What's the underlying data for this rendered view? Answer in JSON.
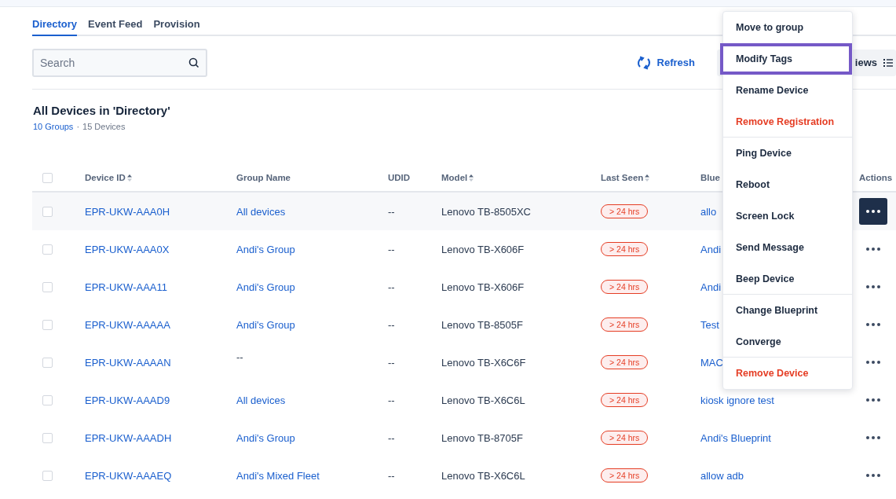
{
  "tabs": [
    {
      "label": "Directory",
      "selected": true
    },
    {
      "label": "Event Feed",
      "selected": false
    },
    {
      "label": "Provision",
      "selected": false
    }
  ],
  "search": {
    "placeholder": "Search"
  },
  "toolbar": {
    "refresh": "Refresh",
    "views": "iews"
  },
  "select_all": {
    "checked": false
  },
  "heading": {
    "title": "All Devices in 'Directory'",
    "groups_link": "10 Groups",
    "separator": "·",
    "devices": "15 Devices"
  },
  "table": {
    "columns": [
      {
        "label": "Device ID",
        "sortable": true
      },
      {
        "label": "Group Name",
        "sortable": false
      },
      {
        "label": "UDID",
        "sortable": false
      },
      {
        "label": "Model",
        "sortable": true
      },
      {
        "label": "Last Seen",
        "sortable": true
      },
      {
        "label": "Blue",
        "sortable": false
      },
      {
        "label": "Actions",
        "sortable": false
      }
    ],
    "rows": [
      {
        "device_id": "EPR-UKW-AAA0H",
        "group": "All devices",
        "udid": "--",
        "model": "Lenovo TB-8505XC",
        "last_seen": "> 24 hrs",
        "blueprint": "allo",
        "selected": true
      },
      {
        "device_id": "EPR-UKW-AAA0X",
        "group": "Andi's Group",
        "udid": "--",
        "model": "Lenovo TB-X606F",
        "last_seen": "> 24 hrs",
        "blueprint": "Andi",
        "selected": false
      },
      {
        "device_id": "EPR-UKW-AAA11",
        "group": "Andi's Group",
        "udid": "--",
        "model": "Lenovo TB-X606F",
        "last_seen": "> 24 hrs",
        "blueprint": "Andi",
        "selected": false
      },
      {
        "device_id": "EPR-UKW-AAAAA",
        "group": "Andi's Group",
        "udid": "--",
        "model": "Lenovo TB-8505F",
        "last_seen": "> 24 hrs",
        "blueprint": "Test",
        "selected": false
      },
      {
        "device_id": "EPR-UKW-AAAAN",
        "group": "--",
        "udid": "--",
        "model": "Lenovo TB-X6C6F",
        "last_seen": "> 24 hrs",
        "blueprint": "MAC",
        "selected": false
      },
      {
        "device_id": "EPR-UKW-AAAD9",
        "group": "All devices",
        "udid": "--",
        "model": "Lenovo TB-X6C6L",
        "last_seen": "> 24 hrs",
        "blueprint": "kiosk ignore test",
        "selected": false
      },
      {
        "device_id": "EPR-UKW-AAADH",
        "group": "Andi's Group",
        "udid": "--",
        "model": "Lenovo TB-8705F",
        "last_seen": "> 24 hrs",
        "blueprint": "Andi's Blueprint",
        "selected": false
      },
      {
        "device_id": "EPR-UKW-AAAEQ",
        "group": "Andi's Mixed Fleet",
        "udid": "--",
        "model": "Lenovo TB-X6C6L",
        "last_seen": "> 24 hrs",
        "blueprint": "allow adb",
        "selected": false
      }
    ]
  },
  "menu": {
    "items": [
      {
        "label": "Move to group",
        "kind": "normal",
        "selected": false,
        "divider_after": false
      },
      {
        "label": "Modify Tags",
        "kind": "normal",
        "selected": true,
        "divider_after": false
      },
      {
        "label": "Rename Device",
        "kind": "normal",
        "selected": false,
        "divider_after": false
      },
      {
        "label": "Remove Registration",
        "kind": "danger",
        "selected": false,
        "divider_after": true
      },
      {
        "label": "Ping Device",
        "kind": "normal",
        "selected": false,
        "divider_after": false
      },
      {
        "label": "Reboot",
        "kind": "normal",
        "selected": false,
        "divider_after": false
      },
      {
        "label": "Screen Lock",
        "kind": "normal",
        "selected": false,
        "divider_after": false
      },
      {
        "label": "Send Message",
        "kind": "normal",
        "selected": false,
        "divider_after": false
      },
      {
        "label": "Beep Device",
        "kind": "normal",
        "selected": false,
        "divider_after": true
      },
      {
        "label": "Change Blueprint",
        "kind": "normal",
        "selected": false,
        "divider_after": false
      },
      {
        "label": "Converge",
        "kind": "normal",
        "selected": false,
        "divider_after": true
      },
      {
        "label": "Remove Device",
        "kind": "danger",
        "selected": false,
        "divider_after": false
      }
    ]
  }
}
